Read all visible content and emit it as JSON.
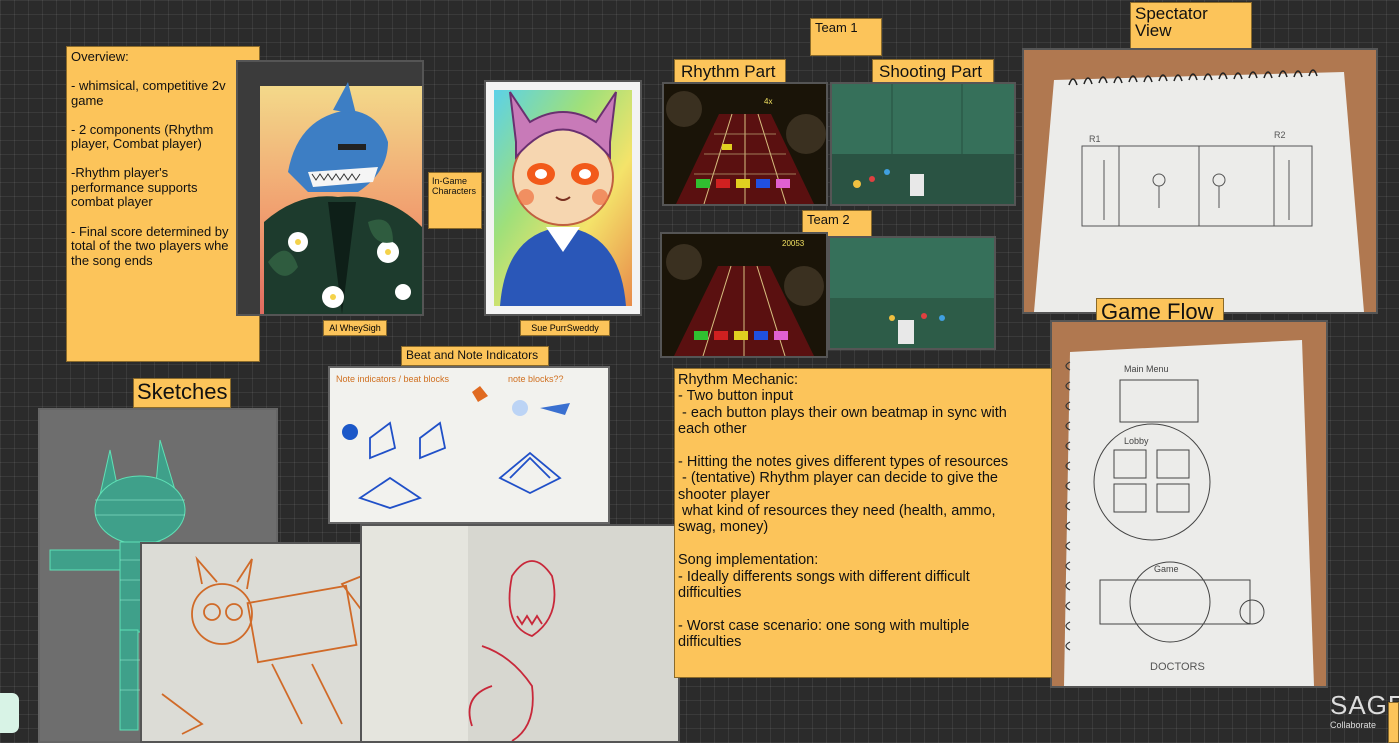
{
  "board": {
    "overview_note": "Overview:\n\n- whimsical, competitive 2v\ngame\n\n- 2 components (Rhythm\nplayer, Combat player)\n\n-Rhythm player's\nperformance supports\ncombat player\n\n- Final score determined by\ntotal of the two players whe\nthe song ends",
    "in_game_characters": "In-Game\nCharacters",
    "caption_shark": "Al WheySigh",
    "caption_cat": "Sue PurrSweddy",
    "team1": "Team 1",
    "team2": "Team 2",
    "rhythm_part": "Rhythm Part",
    "shooting_part": "Shooting Part",
    "spectator_view": "Spectator\nView",
    "game_flow": "Game Flow",
    "sketches": "Sketches",
    "beat_note_indicators": "Beat and Note Indicators",
    "rhythm_mechanic_note": "Rhythm Mechanic:\n- Two button input\n - each button plays their own beatmap in sync with\neach other\n\n- Hitting the notes gives different types of resources\n - (tentative) Rhythm player can decide to give the\nshooter player\n what kind of resources they need (health, ammo,\nswag, money)\n\nSong implementation:\n- Ideally differents songs with different difficult\ndifficulties\n\n- Worst case scenario: one song with multiple\ndifficulties",
    "sage_logo": "SAGE",
    "sage_tagline": "Collaborate"
  },
  "sketch_text": {
    "beat_sketch_header": "Note indicators / beat blocks",
    "beat_sketch_note": "note blocks??",
    "spectator_r1": "R1",
    "spectator_r2": "R2",
    "gameflow_main_menu": "Main Menu",
    "gameflow_lobby": "Lobby",
    "gameflow_game": "Game",
    "gameflow_footer": "DOCTORS",
    "hud_score_team2": "20053",
    "hud_mult": "4x"
  },
  "colors": {
    "note_bg": "#fcc45a",
    "board_bg": "#2b2b2b",
    "accent_teal": "#5fe0b5"
  }
}
